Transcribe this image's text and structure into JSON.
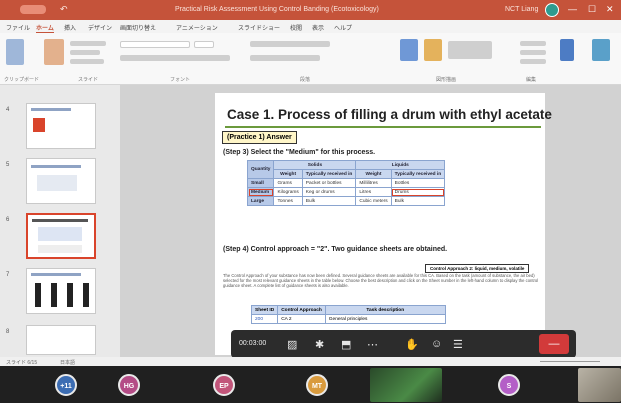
{
  "window": {
    "title": "Practical Risk Assessment Using Control Banding (Ecotoxicology)",
    "user": "NCT Liang",
    "controls": [
      "—",
      "☐",
      "✕"
    ]
  },
  "ribbon_tabs": [
    "ファイル",
    "ホーム",
    "挿入",
    "デザイン",
    "画面切り替え",
    "アニメーション",
    "スライドショー",
    "校閲",
    "表示",
    "ヘルプ"
  ],
  "ribbon_groups": [
    "クリップボード",
    "スライド",
    "フォント",
    "段落",
    "図形描画",
    "編集"
  ],
  "slide_numbers": [
    "4",
    "5",
    "6",
    "7",
    "8"
  ],
  "slide": {
    "title": "Case 1.   Process of filling a drum with ethyl acetate",
    "practice_label": "(Practice 1) Answer",
    "step3": "(Step 3) Select the \"Medium\" for this process.",
    "table": {
      "col_quantity": "Quantity",
      "col_solids": "Solids",
      "col_liquids": "Liquids",
      "sub_weight": "Weight",
      "sub_typical_solid": "Typically received in",
      "sub_weight2": "Weight",
      "sub_typical_liquid": "Typically received in",
      "rows": [
        [
          "Small",
          "Grams",
          "Packet or bottles",
          "Millilitres",
          "Bottles"
        ],
        [
          "Medium",
          "Kilograms",
          "Keg or drums",
          "Litres",
          "Drums"
        ],
        [
          "Large",
          "Tonnes",
          "Bulk",
          "Cubic meters",
          "Bulk"
        ]
      ]
    },
    "step4": "(Step 4) Control approach = \"2\".   Two guidance sheets are obtained.",
    "ca_box": "Control Approach 2: liquid, medium, volatile",
    "paragraph": "The Control Approach of your substance has now been defined. Several guidance sheets are available for this CA. Based on the task (amount of substance, the air bed) selected for the most relevant guidance sheets in the table below. Choose the best description and click on the Sheet number in the left-hand column to display the control guidance sheet. A complete list of guidance sheets is also available.",
    "sheet_table": {
      "col_sheet": "Sheet ID",
      "col_approach": "Control Approach",
      "col_task": "Task description",
      "rows": [
        [
          "200",
          "CA 2",
          "General principles"
        ]
      ]
    }
  },
  "callbar": {
    "timer": "00:03:00",
    "end_label": "—"
  },
  "participants": [
    {
      "initials": "+11",
      "color": "#3c6db3"
    },
    {
      "initials": "HG",
      "color": "#b44c86"
    },
    {
      "initials": "EP",
      "color": "#c2557a"
    },
    {
      "initials": "MT",
      "color": "#d99b3e"
    },
    {
      "initials": "S",
      "color": "#b45fc7"
    }
  ],
  "statusbar": {
    "slide_info": "スライド 6/15",
    "language": "日本語"
  }
}
